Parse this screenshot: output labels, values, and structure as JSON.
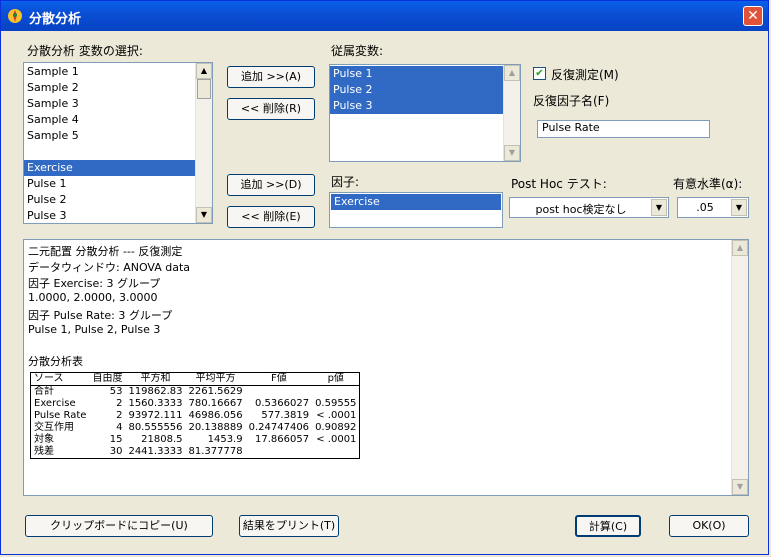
{
  "window": {
    "title": "分散分析",
    "close": "✕"
  },
  "vars": {
    "label": "分散分析 変数の選択:",
    "items": [
      {
        "text": "Sample 1",
        "selected": false
      },
      {
        "text": "Sample 2",
        "selected": false
      },
      {
        "text": "Sample 3",
        "selected": false
      },
      {
        "text": "Sample 4",
        "selected": false
      },
      {
        "text": "Sample 5",
        "selected": false
      },
      {
        "text": "",
        "selected": false
      },
      {
        "text": "Exercise",
        "selected": true
      },
      {
        "text": "Pulse 1",
        "selected": false
      },
      {
        "text": "Pulse 2",
        "selected": false
      },
      {
        "text": "Pulse 3",
        "selected": false
      }
    ]
  },
  "buttons": {
    "add_dep": "追加 >>(A)",
    "remove_dep": "<< 削除(R)",
    "add_factor": "追加 >>(D)",
    "remove_factor": "<< 削除(E)",
    "copy": "クリップボードにコピー(U)",
    "print": "結果をプリント(T)",
    "calc": "計算(C)",
    "ok": "OK(O)"
  },
  "dependent": {
    "label": "従属変数:",
    "items": [
      {
        "text": "Pulse 1",
        "selected": true
      },
      {
        "text": "Pulse 2",
        "selected": true
      },
      {
        "text": "Pulse 3",
        "selected": true
      }
    ]
  },
  "repeated": {
    "checkbox_label": "反復測定(M)",
    "checked": true,
    "factor_name_label": "反復因子名(F)",
    "factor_name_value": "Pulse Rate"
  },
  "factor": {
    "label": "因子:",
    "items": [
      {
        "text": "Exercise",
        "selected": true
      }
    ]
  },
  "posthoc": {
    "label": "Post Hoc テスト:",
    "value": "post hoc検定なし"
  },
  "alpha": {
    "label": "有意水準(α):",
    "value": ".05"
  },
  "output": {
    "lines": [
      "二元配置 分散分析 --- 反復測定",
      "データウィンドウ: ANOVA data",
      "因子 Exercise: 3 グループ",
      "1.0000, 2.0000, 3.0000",
      "因子 Pulse Rate: 3 グループ",
      "Pulse 1, Pulse 2, Pulse 3"
    ],
    "table_title": "分散分析表",
    "table": {
      "headers": [
        "ソース",
        "自由度",
        "平方和",
        "平均平方",
        "F値",
        "p値"
      ],
      "rows": [
        [
          "合計",
          "53",
          "119862.83",
          "2261.5629",
          "",
          ""
        ],
        [
          "Exercise",
          "2",
          "1560.3333",
          "780.16667",
          "0.5366027",
          "0.59555"
        ],
        [
          "Pulse Rate",
          "2",
          "93972.111",
          "46986.056",
          "577.3819",
          "< .0001"
        ],
        [
          "交互作用",
          "4",
          "80.555556",
          "20.138889",
          "0.24747406",
          "0.90892"
        ],
        [
          "対象",
          "15",
          "21808.5",
          "1453.9",
          "17.866057",
          "< .0001"
        ],
        [
          "残差",
          "30",
          "2441.3333",
          "81.377778",
          "",
          ""
        ]
      ]
    }
  }
}
